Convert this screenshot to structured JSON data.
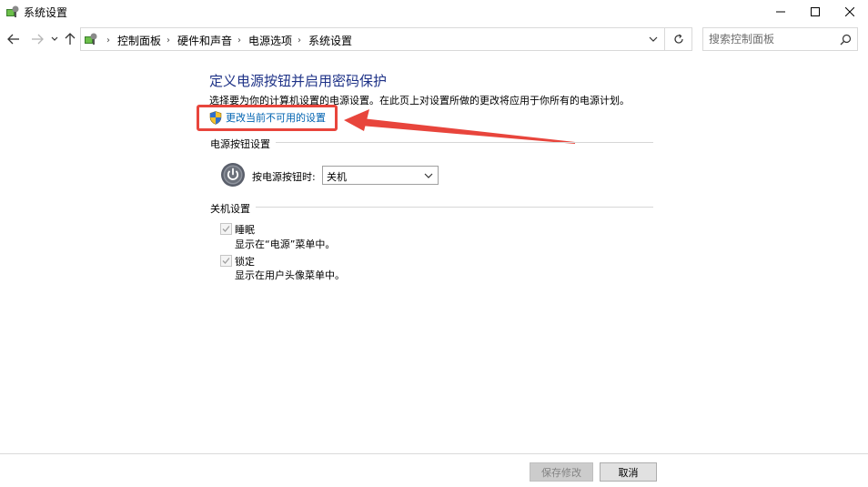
{
  "window": {
    "title": "系统设置"
  },
  "address": {
    "crumbs": [
      "控制面板",
      "硬件和声音",
      "电源选项",
      "系统设置"
    ]
  },
  "search": {
    "placeholder": "搜索控制面板"
  },
  "main": {
    "heading": "定义电源按钮并启用密码保护",
    "subtext": "选择要为你的计算机设置的电源设置。在此页上对设置所做的更改将应用于你所有的电源计划。",
    "change_link": "更改当前不可用的设置",
    "power_section": {
      "title": "电源按钮设置",
      "label": "按电源按钮时:",
      "selected": "关机"
    },
    "shutdown_section": {
      "title": "关机设置",
      "items": [
        {
          "label": "睡眠",
          "desc": "显示在“电源”菜单中。",
          "checked": true,
          "disabled": true
        },
        {
          "label": "锁定",
          "desc": "显示在用户头像菜单中。",
          "checked": true,
          "disabled": true
        }
      ]
    }
  },
  "footer": {
    "save_label": "保存修改",
    "cancel_label": "取消"
  },
  "colors": {
    "heading": "#1e3287",
    "link": "#0063b1",
    "annotation": "#e8453c"
  }
}
